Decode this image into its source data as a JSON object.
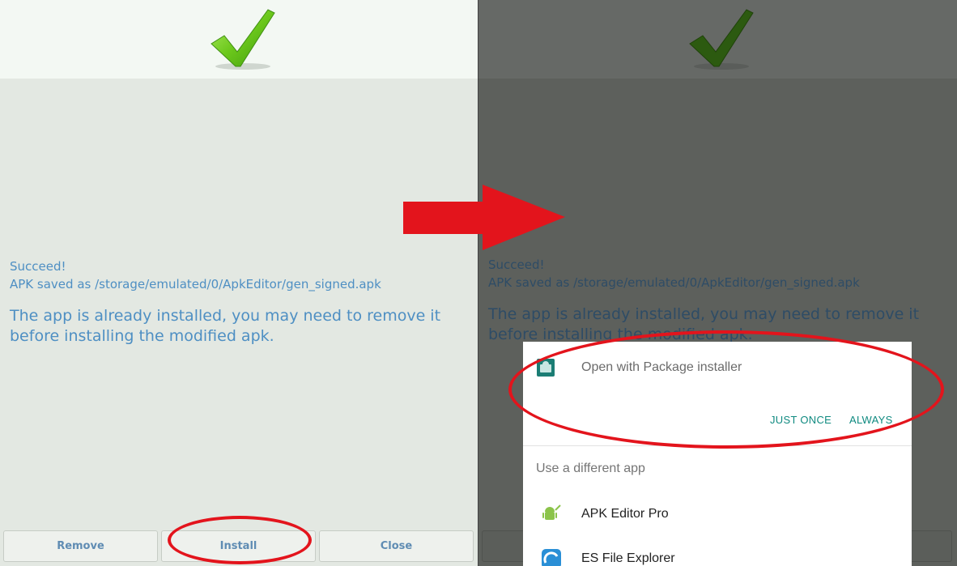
{
  "left_screen": {
    "status": "Succeed!",
    "saved_path": "APK saved as /storage/emulated/0/ApkEditor/gen_signed.apk",
    "notice": "The app is already installed, you may need to remove it before installing the modified apk.",
    "buttons": {
      "remove": "Remove",
      "install": "Install",
      "close": "Close"
    }
  },
  "right_screen": {
    "status": "Succeed!",
    "saved_path": "APK saved as /storage/emulated/0/ApkEditor/gen_signed.apk",
    "notice": "The app is already installed, you may need to remove it before installing the modified apk.",
    "dialog": {
      "title": "Open with Package installer",
      "just_once": "JUST ONCE",
      "always": "ALWAYS",
      "subtitle": "Use a different app",
      "apps": [
        {
          "label": "APK Editor Pro",
          "icon": "android-edit-icon"
        },
        {
          "label": "ES File Explorer",
          "icon": "es-file-explorer-icon"
        }
      ]
    }
  },
  "colors": {
    "highlight": "#e3141c",
    "accent_text": "#4e8fc3",
    "dialog_action": "#0f8a80",
    "check_green": "#5fbf1f"
  }
}
